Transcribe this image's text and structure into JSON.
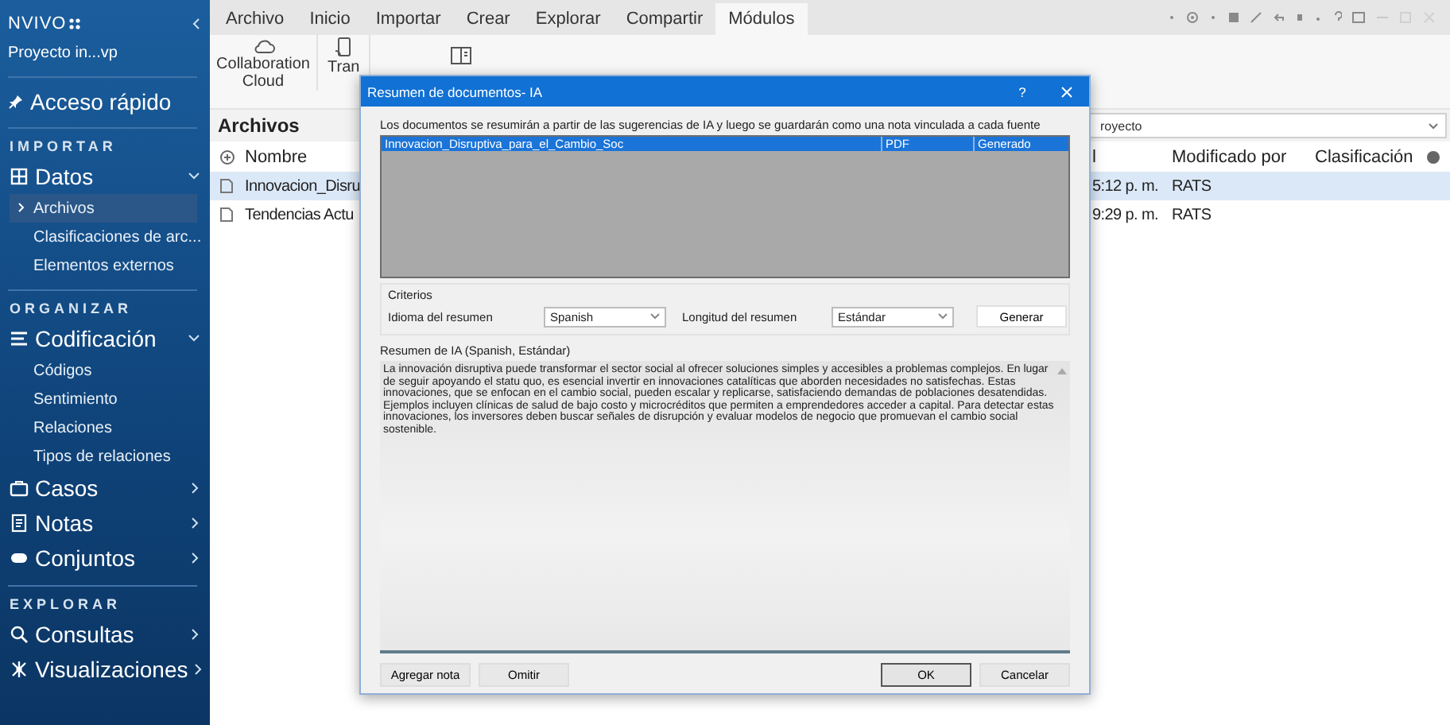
{
  "sidebar": {
    "logo": "NVIVO",
    "project": "Proyecto in...vp",
    "quick_access": "Acceso rápido",
    "sections": [
      {
        "heading": "IMPORTAR",
        "groups": [
          {
            "label": "Datos",
            "expanded": true,
            "children": [
              {
                "label": "Archivos",
                "selected": true
              },
              {
                "label": "Clasificaciones de arc...",
                "selected": false
              },
              {
                "label": "Elementos externos",
                "selected": false
              }
            ]
          }
        ]
      },
      {
        "heading": "ORGANIZAR",
        "groups": [
          {
            "label": "Codificación",
            "expanded": true,
            "children": [
              {
                "label": "Códigos",
                "selected": false
              },
              {
                "label": "Sentimiento",
                "selected": false
              },
              {
                "label": "Relaciones",
                "selected": false
              },
              {
                "label": "Tipos de relaciones",
                "selected": false
              }
            ]
          },
          {
            "label": "Casos",
            "expanded": false
          },
          {
            "label": "Notas",
            "expanded": false
          },
          {
            "label": "Conjuntos",
            "expanded": false
          }
        ]
      },
      {
        "heading": "EXPLORAR",
        "groups": [
          {
            "label": "Consultas",
            "expanded": false
          },
          {
            "label": "Visualizaciones",
            "expanded": false
          }
        ]
      }
    ]
  },
  "menu_tabs": [
    {
      "label": "Archivo",
      "selected": false
    },
    {
      "label": "Inicio",
      "selected": false
    },
    {
      "label": "Importar",
      "selected": false
    },
    {
      "label": "Crear",
      "selected": false
    },
    {
      "label": "Explorar",
      "selected": false
    },
    {
      "label": "Compartir",
      "selected": false
    },
    {
      "label": "Módulos",
      "selected": true
    }
  ],
  "ribbon": [
    {
      "label": "Collaboration Cloud"
    },
    {
      "label": "Tran"
    }
  ],
  "files_panel": {
    "title": "Archivos",
    "search_value": "royecto",
    "columns": {
      "name": "Nombre",
      "column_2": "l",
      "modified_by": "Modificado por",
      "classification": "Clasificación"
    },
    "rows": [
      {
        "name": "Innovacion_Disru",
        "column_2": "5:12 p. m.",
        "modified_by": "RATS",
        "selected": true
      },
      {
        "name": "Tendencias Actu",
        "column_2": "9:29 p. m.",
        "modified_by": "RATS",
        "selected": false
      }
    ]
  },
  "dialog": {
    "title": "Resumen de documentos- IA",
    "help": "?",
    "intro": "Los documentos se resumirán a partir de las sugerencias de IA y luego se guardarán como una nota vinculada a cada fuente",
    "documents": [
      {
        "name": "Innovacion_Disruptiva_para_el_Cambio_Soc",
        "type": "PDF",
        "status": "Generado",
        "selected": true
      }
    ],
    "criteria": {
      "title": "Criterios",
      "language_label": "Idioma del resumen",
      "language": "Spanish",
      "length_label": "Longitud del resumen",
      "length": "Estándar",
      "generate": "Generar"
    },
    "summary_label": "Resumen de IA (Spanish, Estándar)",
    "summary": "La innovación disruptiva puede transformar el sector social al ofrecer soluciones simples y accesibles a problemas complejos. En lugar de seguir apoyando el statu quo, es esencial invertir en innovaciones catalíticas que aborden necesidades no satisfechas. Estas innovaciones, que se enfocan en el cambio social, pueden escalar y replicarse, satisfaciendo demandas de poblaciones desatendidas. Ejemplos incluyen clínicas de salud de bajo costo y microcréditos que permiten a emprendedores acceder a capital. Para detectar estas innovaciones, los inversores deben buscar señales de disrupción y evaluar modelos de negocio que promuevan el cambio social sostenible.",
    "buttons_left": [
      {
        "label": "Agregar nota",
        "default": false
      },
      {
        "label": "Omitir",
        "default": false
      }
    ],
    "buttons_right": [
      {
        "label": "OK",
        "default": true
      },
      {
        "label": "Cancelar",
        "default": false
      }
    ]
  }
}
